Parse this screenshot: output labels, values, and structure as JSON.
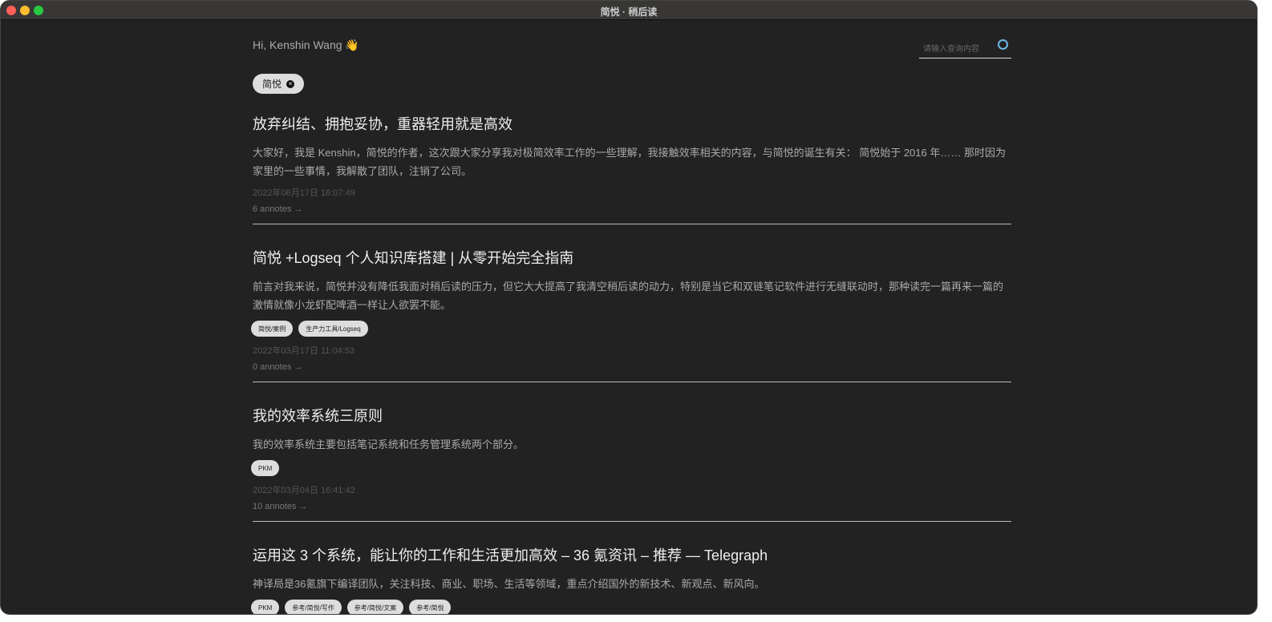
{
  "window": {
    "title": "简悦 · 稍后读"
  },
  "header": {
    "greeting": "Hi, Kenshin Wang 👋",
    "search_placeholder": "请输入查询内容"
  },
  "filter": {
    "label": "简悦"
  },
  "items": [
    {
      "title": "放弃纠结、拥抱妥协，重器轻用就是高效",
      "excerpt": "大家好，我是 Kenshin，简悦的作者，这次跟大家分享我对极简效率工作的一些理解，我接触效率相关的内容，与简悦的诞生有关： 简悦始于 2016 年…… 那时因为家里的一些事情，我解散了团队，注销了公司。",
      "tags": [],
      "date": "2022年06月17日 16:07:49",
      "annotes": "6 annotes →"
    },
    {
      "title": "简悦 +Logseq 个人知识库搭建 | 从零开始完全指南",
      "excerpt": "前言对我来说，简悦并没有降低我面对稍后读的压力，但它大大提高了我清空稍后读的动力，特别是当它和双链笔记软件进行无缝联动时，那种读完一篇再来一篇的激情就像小龙虾配啤酒一样让人欲罢不能。",
      "tags": [
        "简悦/案例",
        "生产力工具/Logseq"
      ],
      "date": "2022年03月17日 11:04:53",
      "annotes": "0 annotes →"
    },
    {
      "title": "我的效率系统三原则",
      "excerpt": "我的效率系统主要包括笔记系统和任务管理系统两个部分。",
      "tags": [
        "PKM"
      ],
      "date": "2022年03月04日 16:41:42",
      "annotes": "10 annotes →"
    },
    {
      "title": "运用这 3 个系统，能让你的工作和生活更加高效 – 36 氪资讯 – 推荐 — Telegraph",
      "excerpt": "神译局是36氪旗下编译团队，关注科技、商业、职场、生活等领域，重点介绍国外的新技术、新观点、新风向。",
      "tags": [
        "PKM",
        "参考/简悦/写作",
        "参考/简悦/文案",
        "参考/简悦"
      ]
    }
  ]
}
